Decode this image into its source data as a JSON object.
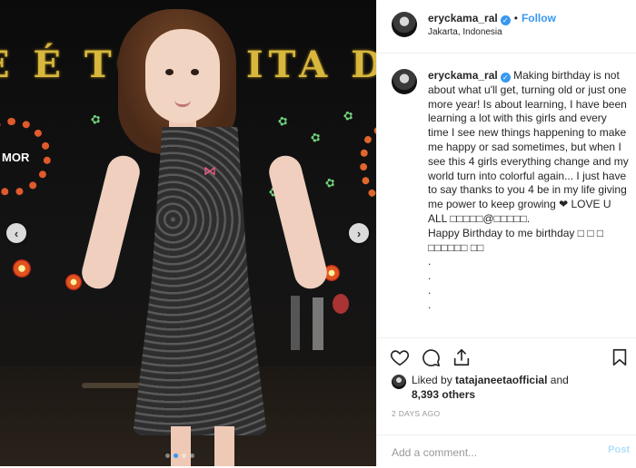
{
  "author": {
    "username": "eryckama_ral",
    "follow_label": "Follow",
    "separator": "•",
    "location": "Jakarta, Indonesia"
  },
  "media": {
    "banner_text": "E É TODO  ITA DE",
    "wreath_left_text": "MOR",
    "prev_icon": "chevron-left-icon",
    "next_icon": "chevron-right-icon",
    "carousel_count": 4,
    "carousel_active_index": 1
  },
  "caption": {
    "username": "eryckama_ral",
    "text": " Making birthday is not about what u'll get, turning old or just one more year! Is about learning, I have been learning a lot with this girls and every time I see new things happening to make me happy or sad sometimes, but when I see this 4 girls everything change and my world turn into colorful again... I just have to say thanks to you 4 be in my life giving me power to keep growing ❤ LOVE U ALL □□□□□@□□□□□.\nHappy Birthday to me birthday □ □ □ □□□□□□ □□\n.\n.\n.\n."
  },
  "actions": {
    "like_icon": "heart-icon",
    "comment_icon": "comment-icon",
    "share_icon": "share-icon",
    "save_icon": "bookmark-icon"
  },
  "likes": {
    "prefix": "Liked by",
    "user": "tatajaneetaofficial",
    "and": "and",
    "count": "8,393 others"
  },
  "timestamp": "2 DAYS AGO",
  "comment": {
    "placeholder": "Add a comment...",
    "post_label": "Post"
  },
  "colors": {
    "accent": "#3897f0",
    "text": "#262626",
    "muted": "#999999",
    "post_disabled": "#b2dffc"
  }
}
